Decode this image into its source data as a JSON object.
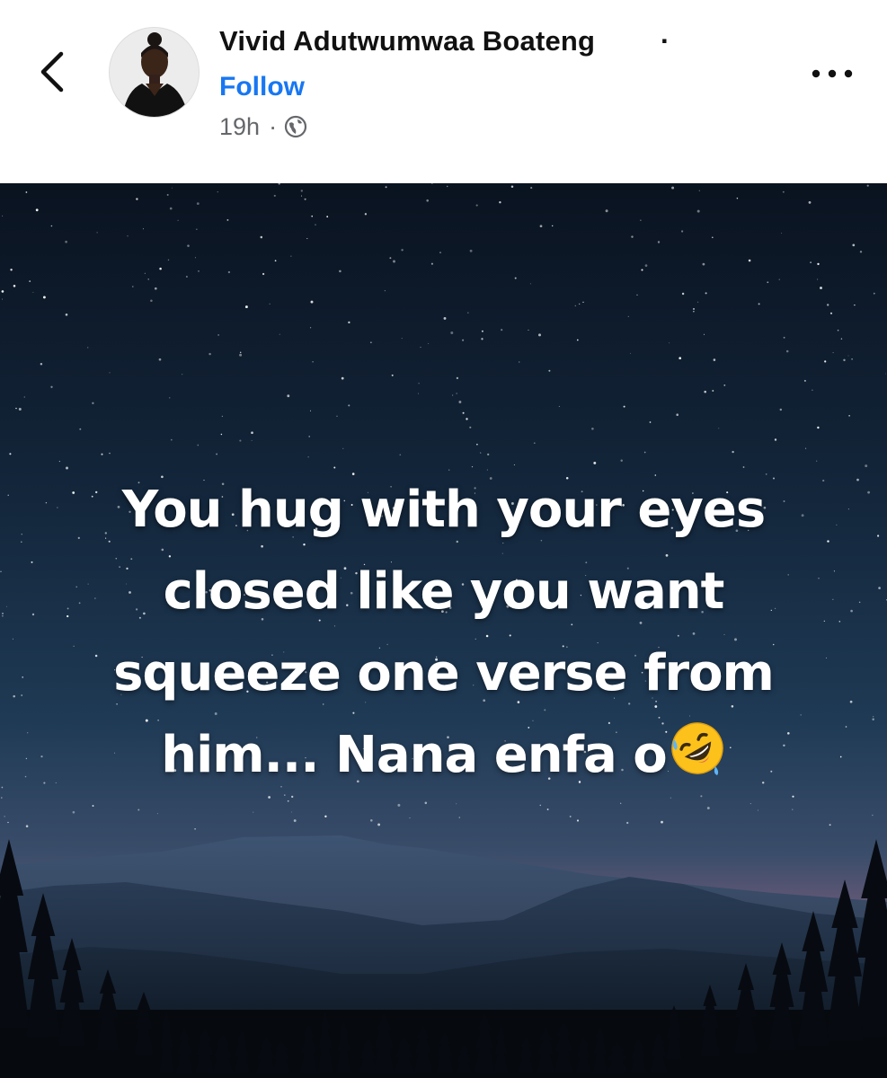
{
  "header": {
    "author_name": "Vivid Adutwumwaa Boateng",
    "name_separator": "·",
    "follow_label": "Follow",
    "timestamp": "19h",
    "meta_separator": "·",
    "privacy_icon": "globe-icon",
    "back_icon": "chevron-left-icon",
    "more_icon": "more-horizontal-icon"
  },
  "post": {
    "text_lines": [
      "You hug with your eyes",
      "closed like you want",
      "squeeze one verse from",
      "him... Nana enfa o"
    ],
    "emoji": "rolling-on-the-floor-laughing-emoji"
  },
  "colors": {
    "accent": "#1877f2",
    "meta_text": "#65676b",
    "sky_top": "#0b1524",
    "sky_mid": "#1e3a55",
    "horizon": "#6b5a78"
  }
}
